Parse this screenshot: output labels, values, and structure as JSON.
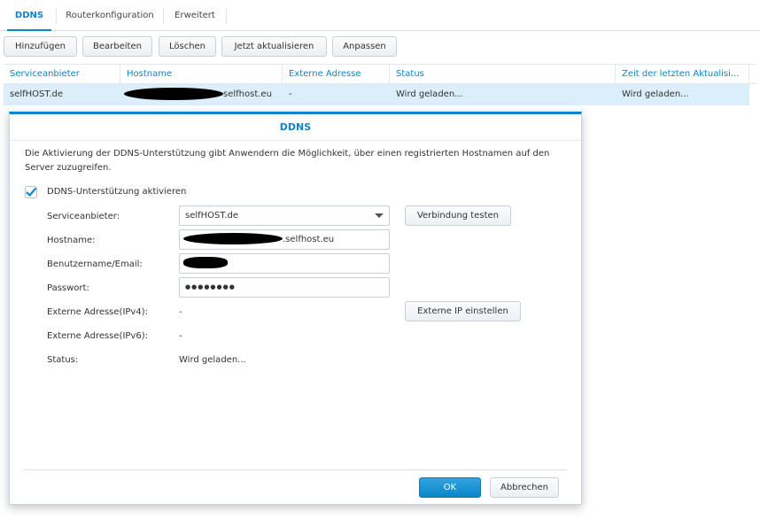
{
  "tabs": [
    "DDNS",
    "Routerkonfiguration",
    "Erweitert"
  ],
  "toolbar": {
    "add": "Hinzufügen",
    "edit": "Bearbeiten",
    "delete": "Löschen",
    "update_now": "Jetzt aktualisieren",
    "customize": "Anpassen"
  },
  "table": {
    "columns": [
      "Serviceanbieter",
      "Hostname",
      "Externe Adresse",
      "Status",
      "Zeit der letzten Aktualisi..."
    ],
    "rows": [
      {
        "provider": "selfHOST.de",
        "hostname_suffix": "selfhost.eu",
        "external_address": "-",
        "status": "Wird geladen...",
        "last_update": "Wird geladen..."
      }
    ]
  },
  "dialog": {
    "title": "DDNS",
    "description": "Die Aktivierung der DDNS-Unterstützung gibt Anwendern die Möglichkeit, über einen registrierten Hostnamen auf den Server zuzugreifen.",
    "enable_label": "DDNS-Unterstützung aktivieren",
    "enabled": true,
    "provider_label": "Serviceanbieter:",
    "provider_value": "selfHOST.de",
    "test_button": "Verbindung testen",
    "hostname_label": "Hostname:",
    "hostname_suffix": ".selfhost.eu",
    "username_label": "Benutzername/Email:",
    "password_label": "Passwort:",
    "password_value": "●●●●●●●●",
    "ipv4_label": "Externe Adresse(IPv4):",
    "ipv4_value": "-",
    "set_ip_button": "Externe IP einstellen",
    "ipv6_label": "Externe Adresse(IPv6):",
    "ipv6_value": "-",
    "status_label": "Status:",
    "status_value": "Wird geladen...",
    "ok_button": "OK",
    "cancel_button": "Abbrechen"
  },
  "colors": {
    "accent": "#0a86c9",
    "selected_row": "#dbeefa"
  }
}
